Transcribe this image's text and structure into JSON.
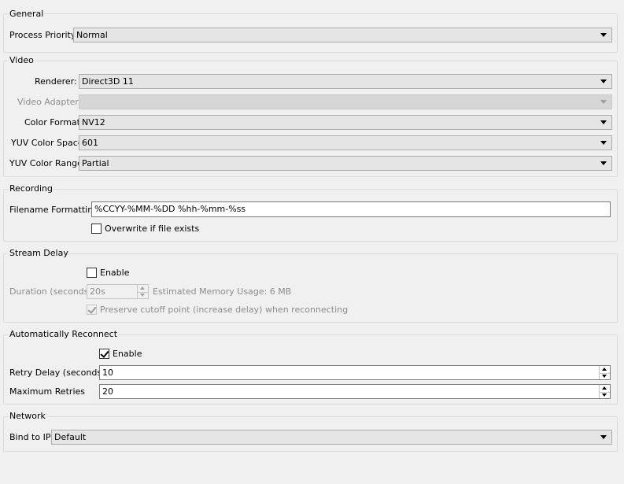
{
  "general": {
    "title": "General",
    "process_priority_label": "Process Priority",
    "process_priority_value": "Normal"
  },
  "video": {
    "title": "Video",
    "renderer_label": "Renderer:",
    "renderer_value": "Direct3D 11",
    "adapter_label": "Video Adapter:",
    "adapter_value": "",
    "color_format_label": "Color Format",
    "color_format_value": "NV12",
    "yuv_space_label": "YUV Color Space",
    "yuv_space_value": "601",
    "yuv_range_label": "YUV Color Range",
    "yuv_range_value": "Partial"
  },
  "recording": {
    "title": "Recording",
    "filename_label": "Filename Formatting",
    "filename_value": "%CCYY-%MM-%DD %hh-%mm-%ss",
    "overwrite_label": "Overwrite if file exists",
    "overwrite_checked": false
  },
  "stream_delay": {
    "title": "Stream Delay",
    "enable_label": "Enable",
    "enable_checked": false,
    "duration_label": "Duration (seconds)",
    "duration_value": "20s",
    "memory_label": "Estimated Memory Usage: 6 MB",
    "preserve_label": "Preserve cutoff point (increase delay) when reconnecting",
    "preserve_checked": true
  },
  "reconnect": {
    "title": "Automatically Reconnect",
    "enable_label": "Enable",
    "enable_checked": true,
    "retry_delay_label": "Retry Delay (seconds)",
    "retry_delay_value": "10",
    "max_retries_label": "Maximum Retries",
    "max_retries_value": "20"
  },
  "network": {
    "title": "Network",
    "bind_label": "Bind to IP",
    "bind_value": "Default"
  }
}
